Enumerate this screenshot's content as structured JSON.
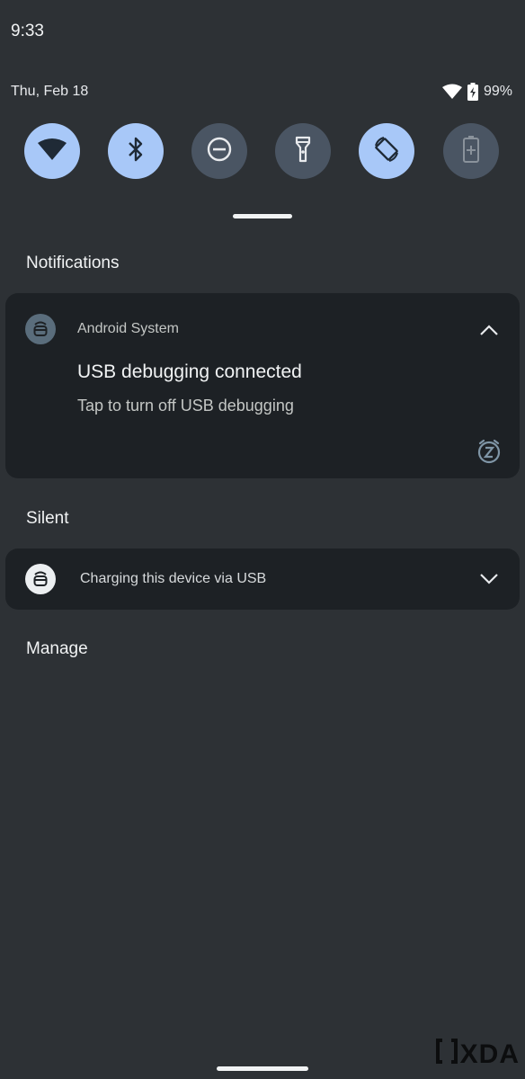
{
  "status_bar": {
    "time": "9:33",
    "date": "Thu, Feb 18",
    "battery": "99%",
    "wifi_icon": "wifi-icon",
    "battery_icon": "battery-charging-icon"
  },
  "quick_settings": [
    {
      "name": "wifi",
      "icon": "wifi-icon",
      "state": "on"
    },
    {
      "name": "bluetooth",
      "icon": "bluetooth-icon",
      "state": "on"
    },
    {
      "name": "do-not-disturb",
      "icon": "dnd-icon",
      "state": "off"
    },
    {
      "name": "flashlight",
      "icon": "flashlight-icon",
      "state": "off"
    },
    {
      "name": "auto-rotate",
      "icon": "rotate-icon",
      "state": "on"
    },
    {
      "name": "battery-saver",
      "icon": "battery-saver-icon",
      "state": "off"
    }
  ],
  "sections": {
    "notifications": "Notifications",
    "silent": "Silent",
    "manage": "Manage"
  },
  "notification": {
    "app": "Android System",
    "title": "USB debugging connected",
    "text": "Tap to turn off USB debugging",
    "icon": "android-system-icon",
    "snooze_icon": "snooze-icon"
  },
  "silent_notification": {
    "text": "Charging this device via USB",
    "icon": "android-system-icon"
  },
  "watermark": "XDA",
  "colors": {
    "background": "#2d3135",
    "card": "#1d2125",
    "tile_on": "#a8c8f8",
    "tile_off": "#4a5563"
  }
}
